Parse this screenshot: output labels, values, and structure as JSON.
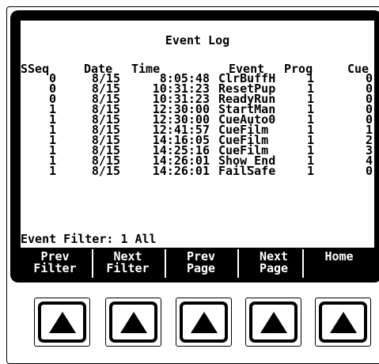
{
  "title": "Event Log",
  "columns": {
    "sseq": "SSeq",
    "date": "Date",
    "time": "Time",
    "event": "Event",
    "prog": "Prog",
    "cue": "Cue"
  },
  "rows": [
    {
      "sseq": "0",
      "date": "8/15",
      "time": "8:05:48",
      "event": "ClrBuffH",
      "prog": "1",
      "cue": "0"
    },
    {
      "sseq": "0",
      "date": "8/15",
      "time": "10:31:23",
      "event": "ResetPup",
      "prog": "1",
      "cue": "0"
    },
    {
      "sseq": "0",
      "date": "8/15",
      "time": "10:31:23",
      "event": "ReadyRun",
      "prog": "1",
      "cue": "0"
    },
    {
      "sseq": "1",
      "date": "8/15",
      "time": "12:30:00",
      "event": "StartMan",
      "prog": "1",
      "cue": "0"
    },
    {
      "sseq": "1",
      "date": "8/15",
      "time": "12:30:00",
      "event": "CueAuto0",
      "prog": "1",
      "cue": "0"
    },
    {
      "sseq": "1",
      "date": "8/15",
      "time": "12:41:57",
      "event": "CueFilm",
      "prog": "1",
      "cue": "1"
    },
    {
      "sseq": "1",
      "date": "8/15",
      "time": "14:16:05",
      "event": "CueFilm",
      "prog": "1",
      "cue": "2"
    },
    {
      "sseq": "1",
      "date": "8/15",
      "time": "14:25:16",
      "event": "CueFilm",
      "prog": "1",
      "cue": "3"
    },
    {
      "sseq": "1",
      "date": "8/15",
      "time": "14:26:01",
      "event": "Show_End",
      "prog": "1",
      "cue": "4"
    },
    {
      "sseq": "1",
      "date": "8/15",
      "time": "14:26:01",
      "event": "FailSafe",
      "prog": "1",
      "cue": "0"
    }
  ],
  "filter": {
    "label": "Event Filter:",
    "value": "1 All"
  },
  "softkeys": [
    {
      "line1": "Prev",
      "line2": "Filter"
    },
    {
      "line1": "Next",
      "line2": "Filter"
    },
    {
      "line1": "Prev",
      "line2": "Page"
    },
    {
      "line1": "Next",
      "line2": "Page"
    },
    {
      "line1": "Home",
      "line2": ""
    }
  ],
  "hardware_buttons": [
    {
      "icon": "up-triangle-icon"
    },
    {
      "icon": "up-triangle-icon"
    },
    {
      "icon": "up-triangle-icon"
    },
    {
      "icon": "up-triangle-icon"
    },
    {
      "icon": "up-triangle-icon"
    }
  ]
}
